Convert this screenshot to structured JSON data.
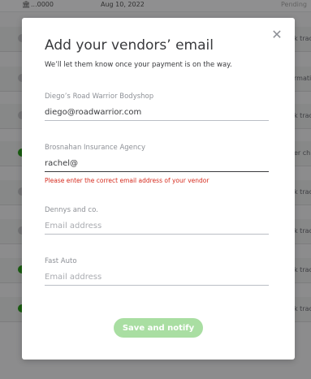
{
  "background": {
    "topbar": {
      "id": "...0000",
      "date": "Aug 10, 2022",
      "status": "Pending"
    },
    "rows": [
      {
        "trail": "k trac"
      },
      {
        "trail": "rmatio"
      },
      {
        "trail": "k trac"
      },
      {
        "trail": "er ch"
      },
      {
        "trail": "k trac"
      },
      {
        "trail": "k trac"
      },
      {
        "trail": "k trac"
      },
      {
        "trail": "k trac"
      }
    ]
  },
  "modal": {
    "close_icon": "✕",
    "title": "Add your vendors’ email",
    "subtitle": "We’ll let them know once your payment is on the way.",
    "fields": [
      {
        "label": "Diego’s Road Warrior Bodyshop",
        "value": "diego@roadwarrior.com",
        "placeholder": ""
      },
      {
        "label": "Brosnahan Insurance Agency",
        "value": "rachel@",
        "placeholder": "",
        "error": "Please enter the correct email address of your vendor"
      },
      {
        "label": "Dennys and co.",
        "value": "",
        "placeholder": "Email address"
      },
      {
        "label": "Fast Auto",
        "value": "",
        "placeholder": "Email address"
      }
    ],
    "submit_label": "Save and notify"
  },
  "colors": {
    "error": "#d52b1e",
    "button_disabled": "#a9dea2",
    "brand_green": "#2ca01c"
  }
}
